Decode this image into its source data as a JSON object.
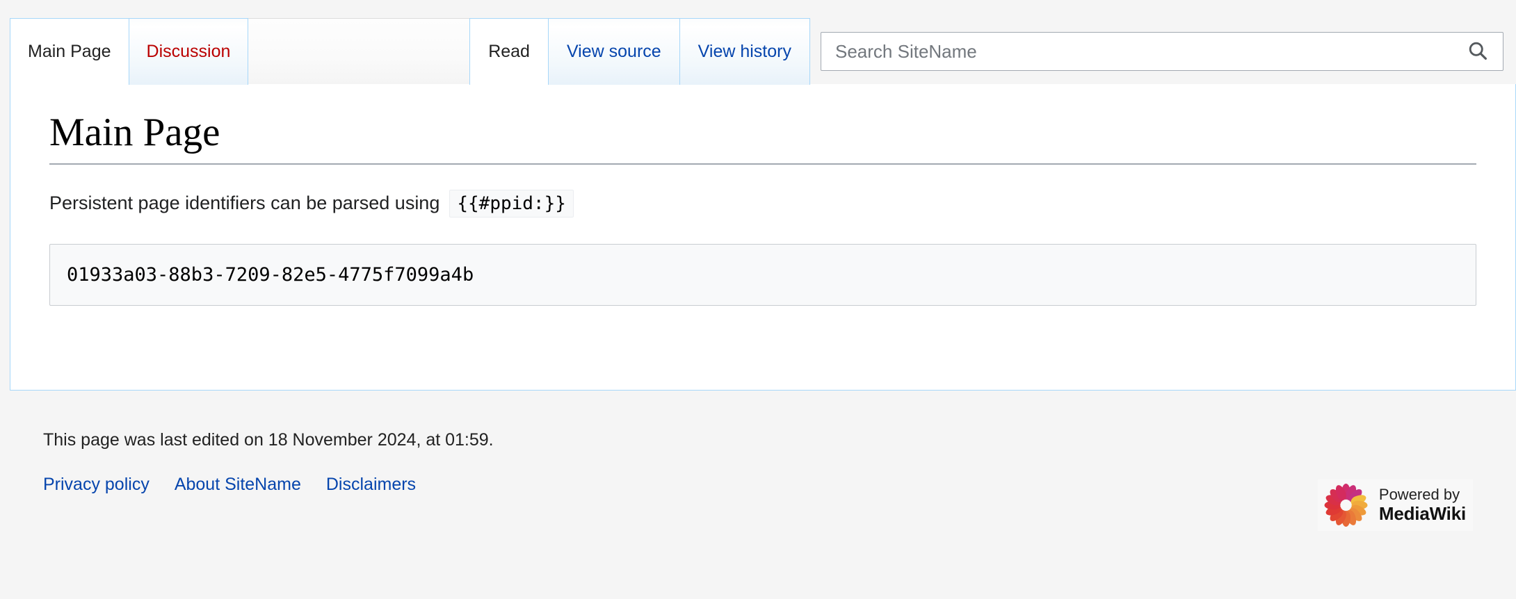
{
  "namespace_tabs": [
    {
      "label": "Main Page",
      "state": "selected",
      "link_type": "normal"
    },
    {
      "label": "Discussion",
      "state": "inactive",
      "link_type": "new"
    }
  ],
  "action_tabs": [
    {
      "label": "Read",
      "state": "selected"
    },
    {
      "label": "View source",
      "state": "inactive"
    },
    {
      "label": "View history",
      "state": "inactive"
    }
  ],
  "search": {
    "placeholder": "Search SiteName",
    "value": "",
    "icon": "search-icon"
  },
  "main": {
    "heading": "Main Page",
    "paragraph_text": "Persistent page identifiers can be parsed using",
    "inline_code": "{{#ppid:}}",
    "code_block": "01933a03-88b3-7209-82e5-4775f7099a4b"
  },
  "footer": {
    "last_edited": "This page was last edited on 18 November 2024, at 01:59.",
    "links": [
      {
        "label": "Privacy policy"
      },
      {
        "label": "About SiteName"
      },
      {
        "label": "Disclaimers"
      }
    ],
    "badge": {
      "line1": "Powered by",
      "line2": "MediaWiki",
      "logo": "mediawiki-sunflower-icon"
    }
  },
  "colors": {
    "link_blue": "#0645ad",
    "new_link_red": "#ba0000",
    "tab_border_blue": "#a7d7f9",
    "page_background": "#f5f5f5",
    "content_background": "#ffffff",
    "code_background": "#f8f9fa",
    "heading_rule": "#a2a9b1"
  }
}
